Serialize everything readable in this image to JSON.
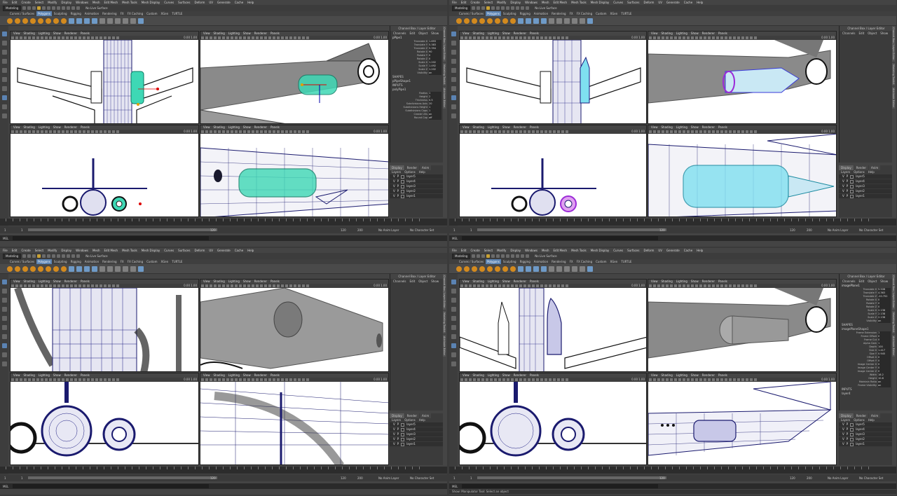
{
  "menus": [
    "File",
    "Edit",
    "Create",
    "Select",
    "Modify",
    "Display",
    "Windows",
    "Mesh",
    "Edit Mesh",
    "Mesh Tools",
    "Mesh Display",
    "Curves",
    "Surfaces",
    "Deform",
    "UV",
    "Generate",
    "Cache",
    "Help"
  ],
  "mode": "Modeling",
  "no_live_surface": "No Live Surface",
  "shelf_tabs": [
    "Curves / Surfaces",
    "Polygons",
    "Sculpting",
    "Rigging",
    "Animation",
    "Rendering",
    "FX",
    "FX Caching",
    "Custom",
    "XGen",
    "TURTLE"
  ],
  "active_shelf": "Polygons",
  "viewport_menu": [
    "View",
    "Shading",
    "Lighting",
    "Show",
    "Renderer",
    "Panels"
  ],
  "vp_field_a": "0.00",
  "vp_field_b": "1.00",
  "channel_box_title": "Channel Box / Layer Editor",
  "channel_menu": [
    "Channels",
    "Edit",
    "Object",
    "Show"
  ],
  "layer_tabs": [
    "Display",
    "Render",
    "Anim"
  ],
  "layer_opts": [
    "Layers",
    "Options",
    "Help"
  ],
  "layers_vp": [
    "V",
    "P"
  ],
  "timeline": {
    "start": "1",
    "end": "120",
    "range_end": "120",
    "anim_end": "200",
    "current": "1",
    "no_anim_layer": "No Anim Layer",
    "no_char_set": "No Character Set"
  },
  "mel_label": "MEL",
  "help_line": "Show: Manipulator Tool: Select an object",
  "side_tabs": [
    "Channel Box / Layer Editor",
    "Modeling Toolkit",
    "Attribute Editor"
  ],
  "panes": [
    {
      "object": "pPipe1",
      "attrs": [
        [
          "Translate X",
          "1.693"
        ],
        [
          "Translate Y",
          "5.383"
        ],
        [
          "Translate Z",
          "5.394"
        ],
        [
          "Rotate X",
          "90"
        ],
        [
          "Rotate Y",
          "0"
        ],
        [
          "Rotate Z",
          "0"
        ],
        [
          "Scale X",
          "1.202"
        ],
        [
          "Scale Y",
          "1.492"
        ],
        [
          "Scale Z",
          "1.202"
        ],
        [
          "Visibility",
          "on"
        ]
      ],
      "shapes_title": "SHAPES",
      "shapes": [
        "pPipeShape1"
      ],
      "inputs_title": "INPUTS",
      "inputs": [
        "polyPipe1"
      ],
      "input_attrs": [
        [
          "Radius",
          "1"
        ],
        [
          "Height",
          "2"
        ],
        [
          "Thickness",
          "0.5"
        ],
        [
          "Subdivisions Axis",
          "20"
        ],
        [
          "Subdivisions Height",
          "1"
        ],
        [
          "Subdivisions Caps",
          "1"
        ],
        [
          "Create UVs",
          "on"
        ],
        [
          "Round Cap",
          "off"
        ]
      ],
      "layers": [
        "layer5",
        "layer4",
        "layer3",
        "layer2",
        "layer1"
      ]
    },
    {
      "object": "",
      "attrs": [],
      "shapes_title": "",
      "shapes": [],
      "inputs_title": "",
      "inputs": [],
      "input_attrs": [],
      "layers": [
        "layer5",
        "layer4",
        "layer3",
        "layer2",
        "layer1"
      ]
    },
    {
      "object": "",
      "attrs": [],
      "shapes_title": "",
      "shapes": [],
      "inputs_title": "",
      "inputs": [],
      "input_attrs": [],
      "layers": [
        "layer5",
        "layer4",
        "layer3",
        "layer2",
        "layer1"
      ]
    },
    {
      "object": "imagePlane1",
      "attrs": [
        [
          "Translate X",
          "5.508"
        ],
        [
          "Translate Y",
          "4.363"
        ],
        [
          "Translate Z",
          "-20.752"
        ],
        [
          "Rotate X",
          "0"
        ],
        [
          "Rotate Y",
          "0"
        ],
        [
          "Rotate Z",
          "0"
        ],
        [
          "Scale X",
          "2.138"
        ],
        [
          "Scale Y",
          "2.138"
        ],
        [
          "Scale Z",
          "2.138"
        ],
        [
          "Visibility",
          "on"
        ]
      ],
      "shapes_title": "SHAPES",
      "shapes": [
        "imagePlaneShape1"
      ],
      "inputs_title": "",
      "inputs": [],
      "input_attrs": [
        [
          "Frame Extension",
          "1"
        ],
        [
          "Frame Offset",
          "0"
        ],
        [
          "Frame Cut",
          "0"
        ],
        [
          "Alpha Gain",
          "1"
        ],
        [
          "Depth",
          "100"
        ],
        [
          "Size X",
          "1.417"
        ],
        [
          "Size Y",
          "0.945"
        ],
        [
          "Offset X",
          "0"
        ],
        [
          "Offset Y",
          "0"
        ],
        [
          "Image Center X",
          "0"
        ],
        [
          "Image Center Y",
          "0"
        ],
        [
          "Image Center Z",
          "0"
        ],
        [
          "Width",
          "18.2"
        ],
        [
          "Height",
          "10.8"
        ],
        [
          "Maintain Ratio",
          "on"
        ],
        [
          "Frame Visibility",
          "on"
        ]
      ],
      "inputs_title2": "INPUTS",
      "inputs2": [
        "layer4"
      ],
      "layers": [
        "layer5",
        "layer4",
        "layer3",
        "layer2",
        "layer1"
      ]
    }
  ]
}
